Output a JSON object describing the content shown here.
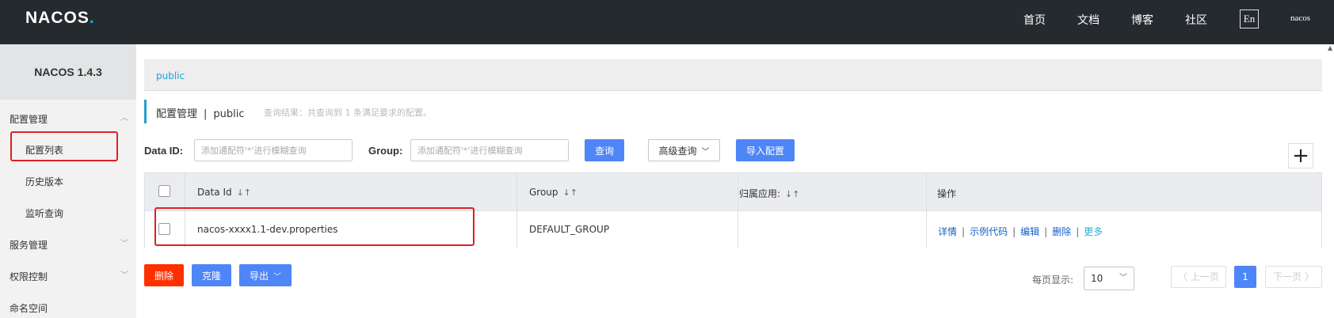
{
  "brand": {
    "logo_main": "NACOS",
    "logo_dot": "."
  },
  "topnav": {
    "items": [
      "首页",
      "文档",
      "博客",
      "社区"
    ],
    "lang": "En",
    "user": "nacos"
  },
  "sidebar": {
    "version": "NACOS 1.4.3",
    "groups": [
      {
        "label": "配置管理",
        "caret": "^"
      },
      {
        "label": "服务管理",
        "caret": "v"
      },
      {
        "label": "权限控制",
        "caret": "v"
      },
      {
        "label": "命名空间"
      }
    ],
    "items": [
      "配置列表",
      "历史版本",
      "监听查询"
    ]
  },
  "breadcrumb": {
    "namespace": "public"
  },
  "header": {
    "title": "配置管理",
    "separator": "|",
    "namespace": "public",
    "result_info": "查询结果：共查询到 1 条满足要求的配置。"
  },
  "search": {
    "data_id_label": "Data ID:",
    "data_id_placeholder": "添加通配符'*'进行模糊查询",
    "group_label": "Group:",
    "group_placeholder": "添加通配符'*'进行模糊查询",
    "query_button": "查询",
    "advanced_button": "高级查询",
    "import_button": "导入配置",
    "add_symbol": "+"
  },
  "table": {
    "headers": [
      "Data Id",
      "Group",
      "归属应用:",
      "操作"
    ],
    "sort_symbol": "↓↑",
    "rows": [
      {
        "data_id": "nacos-xxxx1.1-dev.properties",
        "group": "DEFAULT_GROUP",
        "app": ""
      }
    ],
    "operations": [
      "详情",
      "示例代码",
      "编辑",
      "删除",
      "更多"
    ],
    "op_separator": "|"
  },
  "bulk": {
    "delete": "删除",
    "clone": "克隆",
    "export": "导出"
  },
  "pagination": {
    "per_page_label": "每页显示:",
    "per_page_value": "10",
    "prev": "上一页",
    "next": "下一页",
    "current_page": "1"
  },
  "colors": {
    "accent": "#4e85f7",
    "danger": "#ff3000",
    "link": "#1ea1d1",
    "topbar": "#252a2f",
    "highlight": "#e02020"
  }
}
